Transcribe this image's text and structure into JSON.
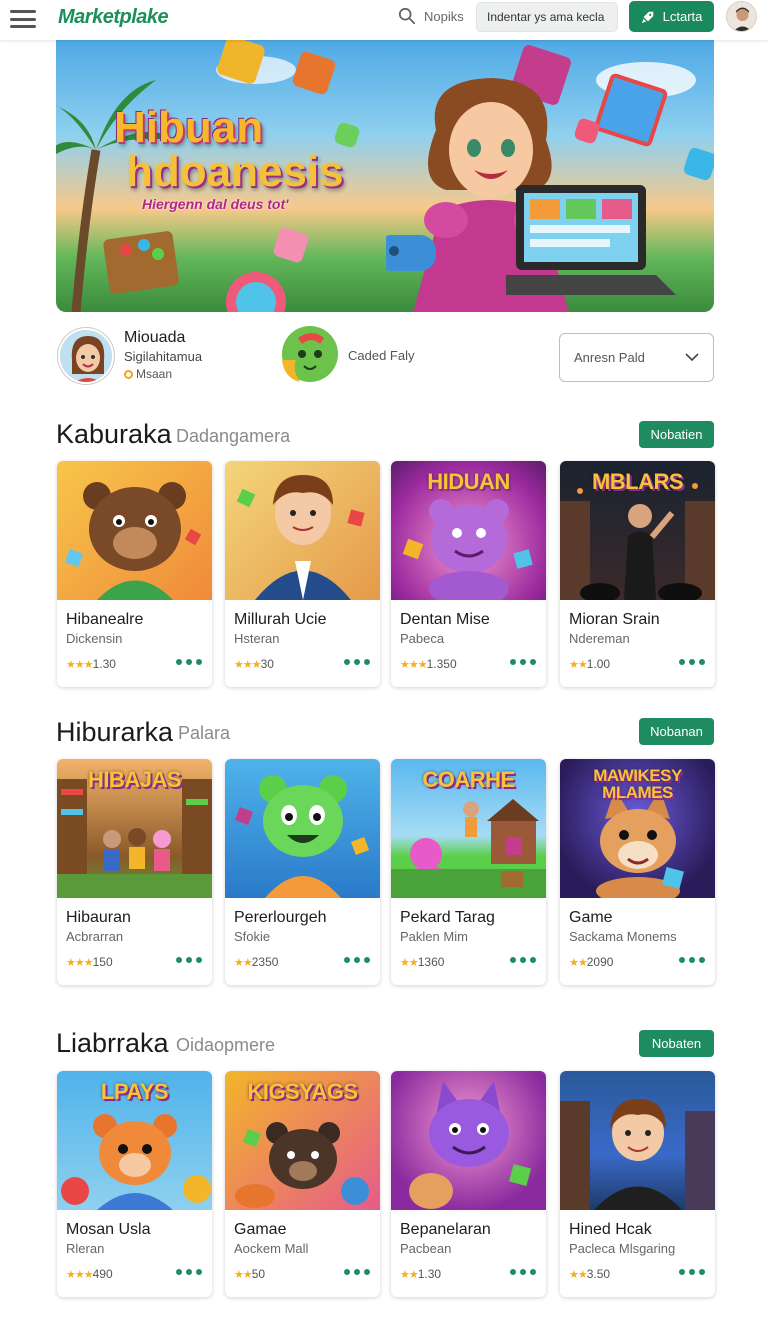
{
  "header": {
    "brand": "Marketplake",
    "search_label": "Nopiks",
    "search_placeholder": "Indentar ys ama kecla",
    "cta_label": "Lctarta"
  },
  "hero": {
    "title_line1": "Hibuan",
    "title_line2": "hdoanesis",
    "subtitle": "Hiergenn dal deus tot'"
  },
  "featured": {
    "name": "Miouada",
    "subtitle": "Sigilahitamua",
    "badge": "Msaan",
    "logo_label": "Caded Faly",
    "select_value": "Anresn Pald"
  },
  "sections": [
    {
      "title": "Kaburaka",
      "subtitle": "Dadangamera",
      "button": "Nobatien",
      "cards": [
        {
          "image_title": "",
          "title": "Hibanealre",
          "sub": "Dickensin",
          "rating": "1.30"
        },
        {
          "image_title": "",
          "title": "Millurah Ucie",
          "sub": "Hsteran",
          "rating": "30"
        },
        {
          "image_title": "HIDUAN",
          "title": "Dentan Mise",
          "sub": "Pabeca",
          "rating": "1.350"
        },
        {
          "image_title": "MBLARS",
          "title": "Mioran Srain",
          "sub": "Ndereman",
          "rating": "1.00"
        }
      ]
    },
    {
      "title": "Hiburarka",
      "subtitle": "Palara",
      "button": "Nobanan",
      "cards": [
        {
          "image_title": "HIBAJAS",
          "title": "Hibauran",
          "sub": "Acbrarran",
          "rating": "150"
        },
        {
          "image_title": "",
          "title": "Pererlourgeh",
          "sub": "Sfokie",
          "rating": "2350"
        },
        {
          "image_title": "COARHE",
          "title": "Pekard Tarag",
          "sub": "Paklen Mim",
          "rating": "1360"
        },
        {
          "image_title": "MAWIKESY MLAMES",
          "title": "Game",
          "sub": "Sackama Monems",
          "rating": "2090"
        }
      ]
    },
    {
      "title": "Liabrraka",
      "subtitle": "Oidaopmere",
      "button": "Nobaten",
      "cards": [
        {
          "image_title": "LPAYS",
          "title": "Mosan Usla",
          "sub": "Rleran",
          "rating": "490"
        },
        {
          "image_title": "KIGSYAGS",
          "title": "Gamae",
          "sub": "Aockem Mall",
          "rating": "50"
        },
        {
          "image_title": "",
          "title": "Bepanelaran",
          "sub": "Pacbean",
          "rating": "1.30"
        },
        {
          "image_title": "",
          "title": "Hined Hcak",
          "sub": "Pacleca Mlsgaring",
          "rating": "3.50"
        }
      ]
    }
  ]
}
